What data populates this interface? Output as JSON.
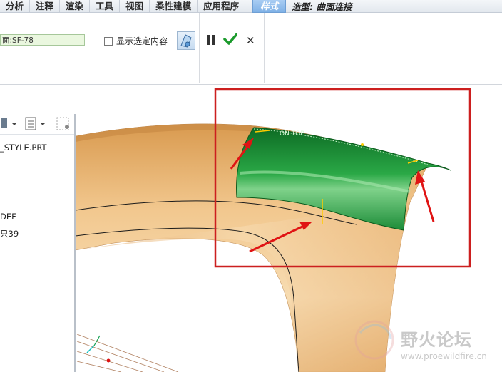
{
  "menubar": {
    "tabs": [
      "分析",
      "注释",
      "渲染",
      "工具",
      "视图",
      "柔性建模",
      "应用程序"
    ],
    "active_tab": "样式",
    "mode_title": "造型: 曲面连接"
  },
  "ribbon": {
    "surface_value": "面:SF-78",
    "show_selected_label": "显示选定内容"
  },
  "tree": {
    "item_model": "_STYLE.PRT",
    "item_def": "DEF",
    "item_39": "只39"
  },
  "viewport": {
    "selected_surface_color": "#1f8f3a",
    "model_color": "#e9b775",
    "highlight_box_color": "#cc1f1f",
    "arrow_color": "#e01414",
    "label_ontop": "ON TOP"
  },
  "watermark": {
    "text": "野火论坛",
    "url": "www.proewildfire.cn"
  }
}
